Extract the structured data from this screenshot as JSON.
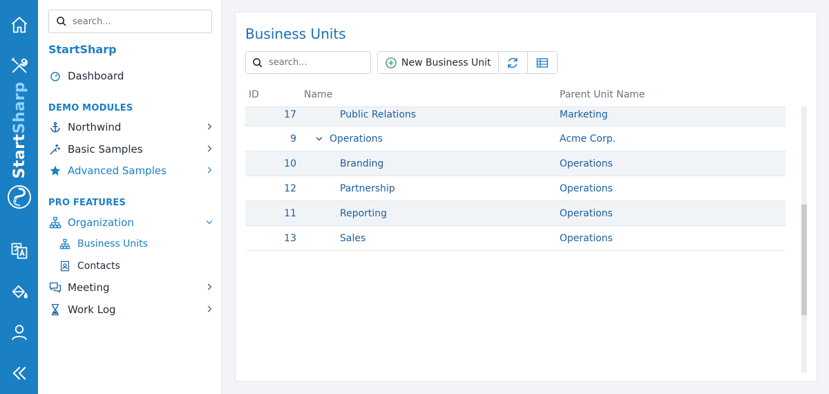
{
  "rail": {
    "brand": {
      "part1": "Start",
      "part2": "Sharp"
    },
    "icons": [
      "home-icon",
      "tools-icon",
      "translate-icon",
      "paint-bucket-icon",
      "user-icon",
      "collapse-icon"
    ]
  },
  "sidebar": {
    "search_placeholder": "search...",
    "app_title": "StartSharp",
    "dashboard": "Dashboard",
    "demo_modules_header": "DEMO MODULES",
    "northwind": "Northwind",
    "basic_samples": "Basic Samples",
    "advanced_samples": "Advanced Samples",
    "pro_features_header": "PRO FEATURES",
    "organization": "Organization",
    "business_units": "Business Units",
    "contacts": "Contacts",
    "meeting": "Meeting",
    "work_log": "Work Log"
  },
  "main": {
    "title": "Business Units",
    "search_placeholder": "search...",
    "new_button": "New Business Unit",
    "columns": {
      "id": "ID",
      "name": "Name",
      "parent": "Parent Unit Name"
    },
    "rows": [
      {
        "id": "17",
        "name": "Public Relations",
        "parent": "Marketing",
        "level": 1,
        "expandable": false
      },
      {
        "id": "9",
        "name": "Operations",
        "parent": "Acme Corp.",
        "level": 0,
        "expandable": true
      },
      {
        "id": "10",
        "name": "Branding",
        "parent": "Operations",
        "level": 1,
        "expandable": false
      },
      {
        "id": "12",
        "name": "Partnership",
        "parent": "Operations",
        "level": 1,
        "expandable": false
      },
      {
        "id": "11",
        "name": "Reporting",
        "parent": "Operations",
        "level": 1,
        "expandable": false
      },
      {
        "id": "13",
        "name": "Sales",
        "parent": "Operations",
        "level": 1,
        "expandable": false
      }
    ]
  },
  "colors": {
    "accent": "#1b7fc4",
    "rail": "#1b7fc4",
    "link": "#1b5e9e",
    "new_icon": "#2e9e5b"
  }
}
